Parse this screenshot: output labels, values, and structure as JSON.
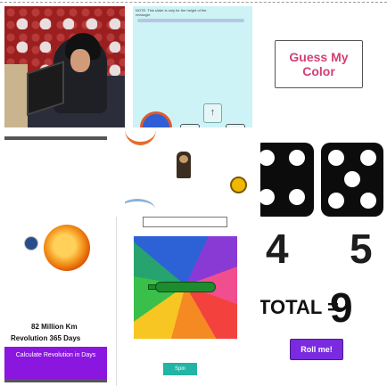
{
  "slider_card": {
    "note": "NOTE: This slider is only for the height of the rectangle",
    "up_arrow": "↑"
  },
  "guess_card": {
    "title": "Guess My Color",
    "accent": "#d23f75"
  },
  "dice_card": {
    "die1": "4",
    "die2": "5",
    "total_label": "TOTAL =",
    "total": "9",
    "button": "Roll me!"
  },
  "sun_card": {
    "distance": "82  Million Km",
    "revolution": "Revolution   365  Days",
    "button": "Calculate Revolution in Days"
  },
  "spinner_card": {
    "button": "Spin"
  }
}
